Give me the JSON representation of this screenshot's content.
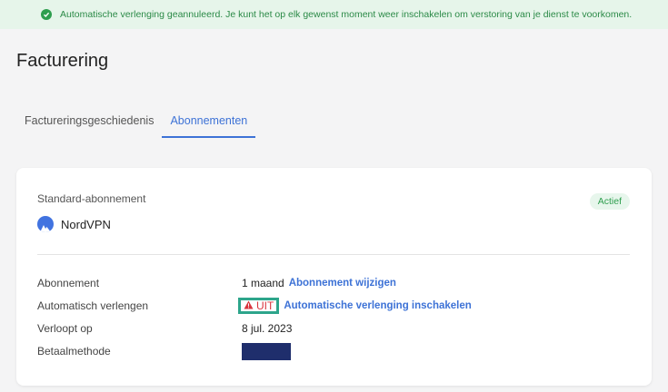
{
  "banner": {
    "message": "Automatische verlenging geannuleerd. Je kunt het op elk gewenst moment weer inschakelen om verstoring van je dienst te voorkomen.",
    "icon": "check-circle-icon",
    "color": "#2e9e4e"
  },
  "page": {
    "title": "Facturering"
  },
  "tabs": [
    {
      "label": "Factureringsgeschiedenis",
      "active": false
    },
    {
      "label": "Abonnementen",
      "active": true
    }
  ],
  "card": {
    "plan_label": "Standard-abonnement",
    "status": "Actief",
    "product": {
      "name": "NordVPN",
      "icon": "nordvpn-logo-icon"
    },
    "rows": {
      "subscription": {
        "label": "Abonnement",
        "value": "1 maand",
        "link": "Abonnement wijzigen"
      },
      "auto_renew": {
        "label": "Automatisch verlengen",
        "value": "UIT",
        "icon": "warning-icon",
        "link": "Automatische verlenging inschakelen"
      },
      "expires": {
        "label": "Verloopt op",
        "value": "8 jul. 2023"
      },
      "payment": {
        "label": "Betaalmethode"
      }
    }
  },
  "colors": {
    "accent": "#3d72d6",
    "danger": "#d9363e",
    "highlight": "#2da58b"
  }
}
